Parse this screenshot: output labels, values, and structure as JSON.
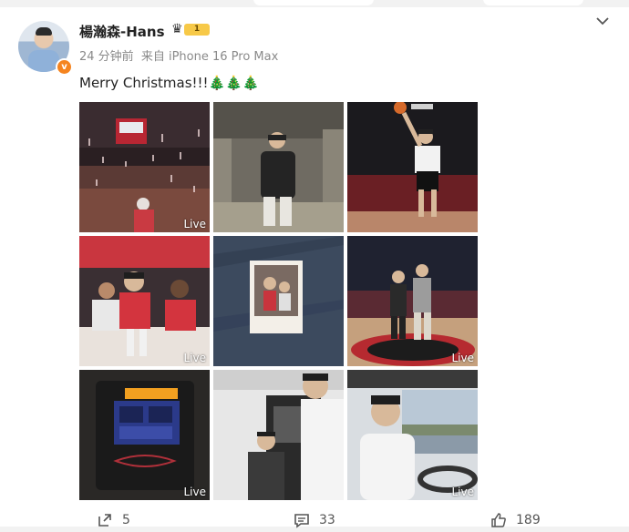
{
  "post": {
    "username": "楊瀚森-Hans",
    "vip_level": "1",
    "time": "24 分钟前",
    "source": "来自 iPhone 16 Pro Max",
    "text": "Merry Christmas!!!🎄🎄🎄"
  },
  "photos": [
    {
      "name": "photo-arena-confetti",
      "live": "Live"
    },
    {
      "name": "photo-parking-garage",
      "live": ""
    },
    {
      "name": "photo-dunk",
      "live": ""
    },
    {
      "name": "photo-teammates-bench",
      "live": "Live"
    },
    {
      "name": "photo-polaroid-on-jeans",
      "live": ""
    },
    {
      "name": "photo-court-duo",
      "live": "Live"
    },
    {
      "name": "photo-arcade-game",
      "live": "Live"
    },
    {
      "name": "photo-selfie-atm",
      "live": ""
    },
    {
      "name": "photo-driving",
      "live": "Live"
    }
  ],
  "actions": {
    "repost_count": "5",
    "comment_count": "33",
    "like_count": "189"
  },
  "colors": {
    "accent_orange": "#f5841f",
    "vip_gold": "#f7c948"
  },
  "icons": [
    "chevron-down-icon",
    "verified-icon",
    "crown-icon",
    "repost-icon",
    "comment-icon",
    "like-icon"
  ]
}
